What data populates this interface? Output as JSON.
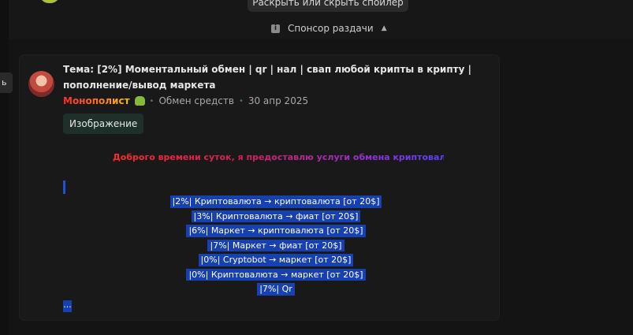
{
  "tooltip": {
    "text": "Раскрыть или скрыть спойлер"
  },
  "sponsor": {
    "label": "Спонсор раздачи"
  },
  "side_tab": {
    "label": "ь"
  },
  "post": {
    "title": "Тема: [2%] Моментальный обмен | qr | нал | свап любой крипты в крипту | пополнение/вывод маркета",
    "author": "Монополист",
    "category": "Обмен средств",
    "date": "30 апр 2025",
    "image_button": "Изображение",
    "greeting": "Доброго времени суток, я предоставлю услуги обмена криптовалюты",
    "offers": [
      "|2%| Криптовалюта → криптовалюта [от 20$]",
      "|3%| Криптовалюта → фиат [от 20$]",
      "|6%| Маркет → криптовалюта [от 20$]",
      "|7%| Маркет → фиат [от 20$]",
      "|0%| Cryptobot → маркет [от 20$]",
      "|0%| Криптовалюта → маркет [от 20$]",
      "|7%| Qr"
    ],
    "ellipsis": "..."
  },
  "icons": {
    "sponsor_info": "info-icon",
    "sponsor_toggle": "chevron-up-icon",
    "author_badge": "frog-icon"
  },
  "colors": {
    "background": "#141414",
    "card": "#191919",
    "highlight": "#1740b0",
    "image_button_bg": "#1f2f2a"
  }
}
